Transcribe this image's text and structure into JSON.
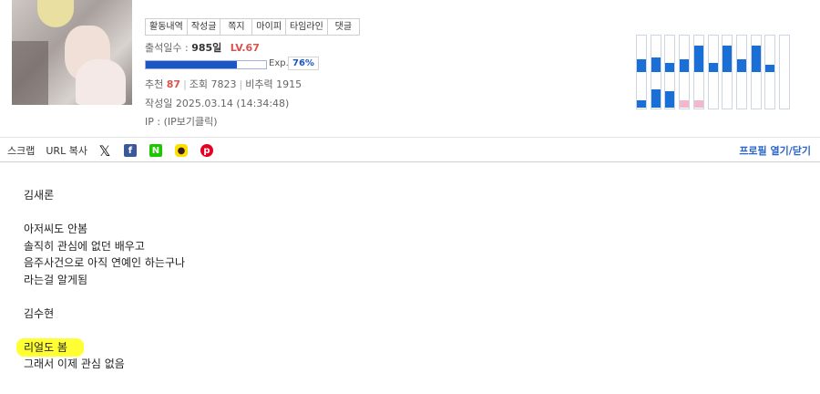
{
  "profile": {
    "tabs": [
      "활동내역",
      "작성글",
      "쪽지",
      "마이피",
      "타임라인",
      "댓글"
    ],
    "attendance_label": "출석일수 :",
    "attendance_value": "985일",
    "level": "LV.67",
    "exp_label": "Exp.",
    "exp_percent": "76%",
    "exp_fraction": 0.76,
    "recommend_label": "추천",
    "recommend_value": "87",
    "views_label": "조회",
    "views_value": "7823",
    "nonrec_label": "비추력",
    "nonrec_value": "1915",
    "date_label": "작성일",
    "date_value": "2025.03.14 (14:34:48)",
    "ip_label": "IP :",
    "ip_value": "(IP보기클릭)"
  },
  "activity_graph": {
    "colors": {
      "up": "#1a6fd6",
      "down": "#f4b8cd"
    },
    "columns": [
      {
        "up": 0.35,
        "down": 0.2,
        "down_color": "up"
      },
      {
        "up": 0.4,
        "down": 0.5,
        "down_color": "up"
      },
      {
        "up": 0.25,
        "down": 0.45,
        "down_color": "up"
      },
      {
        "up": 0.35,
        "down": 0.2,
        "down_color": "pink"
      },
      {
        "up": 0.75,
        "down": 0.2,
        "down_color": "pink"
      },
      {
        "up": 0.25,
        "down": 0.0,
        "down_color": "up"
      },
      {
        "up": 0.75,
        "down": 0.0,
        "down_color": "up"
      },
      {
        "up": 0.35,
        "down": 0.0,
        "down_color": "up"
      },
      {
        "up": 0.75,
        "down": 0.0,
        "down_color": "up"
      },
      {
        "up": 0.2,
        "down": 0.0,
        "down_color": "up"
      },
      {
        "up": 0.0,
        "down": 0.0,
        "down_color": "up"
      }
    ]
  },
  "share": {
    "scrap_label": "스크랩",
    "url_copy_label": "URL 복사",
    "icons": [
      "x-icon",
      "facebook-icon",
      "naver-icon",
      "kakaotalk-icon",
      "pinterest-icon"
    ],
    "profile_toggle": "프로필 열기/닫기"
  },
  "post": {
    "lines": [
      "김새론",
      "",
      "아저씨도 안봄",
      "솔직히 관심에 없던 배우고",
      "음주사건으로 아직 연예인 하는구나",
      "라는걸 알게됨",
      "",
      "김수현",
      "",
      "리얼도 봄",
      "그래서 이제 관심 없음"
    ],
    "highlight_color": "#ffff33"
  }
}
